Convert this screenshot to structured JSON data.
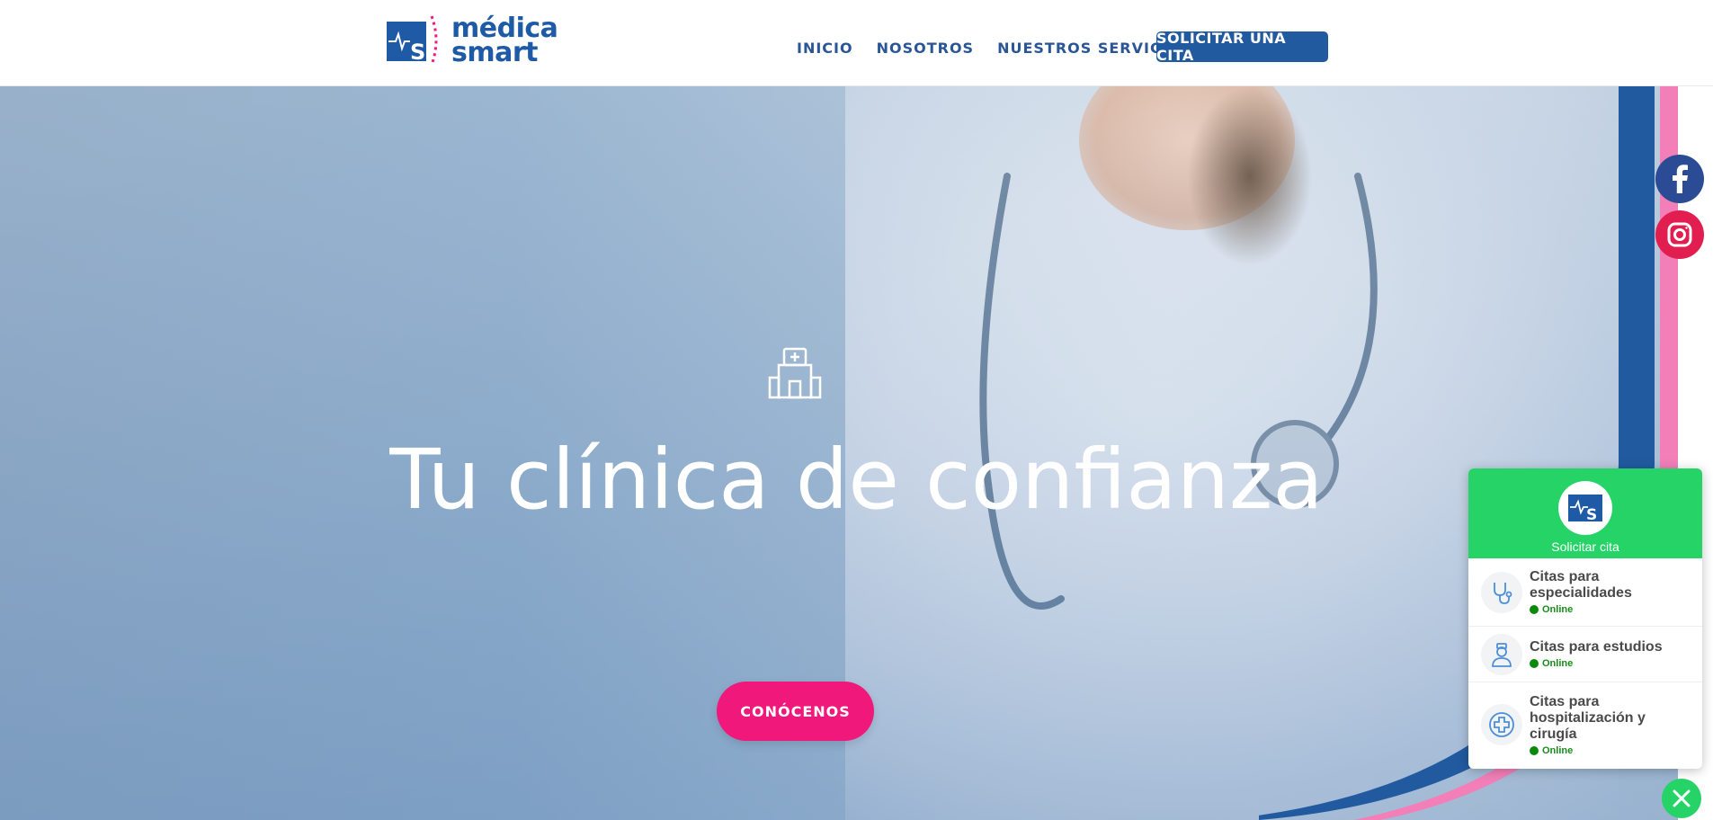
{
  "header": {
    "logo": {
      "line1": "médica",
      "line2": "smart"
    },
    "nav": [
      {
        "label": "INICIO"
      },
      {
        "label": "NOSOTROS"
      },
      {
        "label": "NUESTROS SERVICIOS"
      }
    ],
    "cta_label": "SOLICITAR UNA CITA"
  },
  "hero": {
    "icon": "hospital-icon",
    "title": "Tu clínica de confianza",
    "button_label": "CONÓCENOS"
  },
  "social": [
    {
      "name": "facebook-icon"
    },
    {
      "name": "instagram-icon"
    }
  ],
  "widget": {
    "title": "Solicitar cita",
    "items": [
      {
        "label": "Citas para especialidades",
        "status": "Online",
        "icon": "stethoscope-icon"
      },
      {
        "label": "Citas para estudios",
        "status": "Online",
        "icon": "nurse-icon"
      },
      {
        "label": "Citas para hospitalización y cirugía",
        "status": "Online",
        "icon": "plus-circle-icon"
      }
    ]
  },
  "colors": {
    "brand_blue": "#225aa0",
    "brand_pink": "#f0187a",
    "whatsapp_green": "#25d366"
  }
}
